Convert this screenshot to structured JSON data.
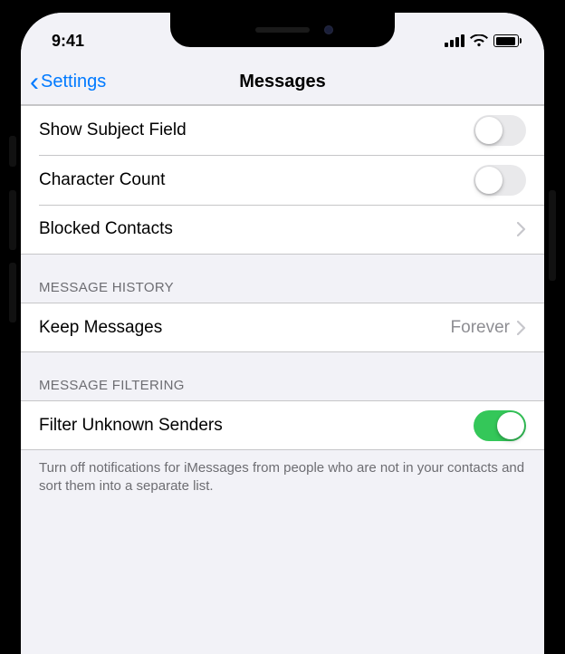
{
  "status": {
    "time": "9:41"
  },
  "nav": {
    "back_label": "Settings",
    "title": "Messages"
  },
  "rows": {
    "show_subject_field": {
      "label": "Show Subject Field",
      "on": false
    },
    "character_count": {
      "label": "Character Count",
      "on": false
    },
    "blocked_contacts": {
      "label": "Blocked Contacts"
    },
    "keep_messages": {
      "label": "Keep Messages",
      "value": "Forever"
    },
    "filter_unknown": {
      "label": "Filter Unknown Senders",
      "on": true
    }
  },
  "sections": {
    "history_header": "Message History",
    "filtering_header": "Message Filtering",
    "filtering_footer": "Turn off notifications for iMessages from people who are not in your contacts and sort them into a separate list."
  },
  "colors": {
    "accent": "#007aff",
    "toggle_on": "#34c759"
  }
}
